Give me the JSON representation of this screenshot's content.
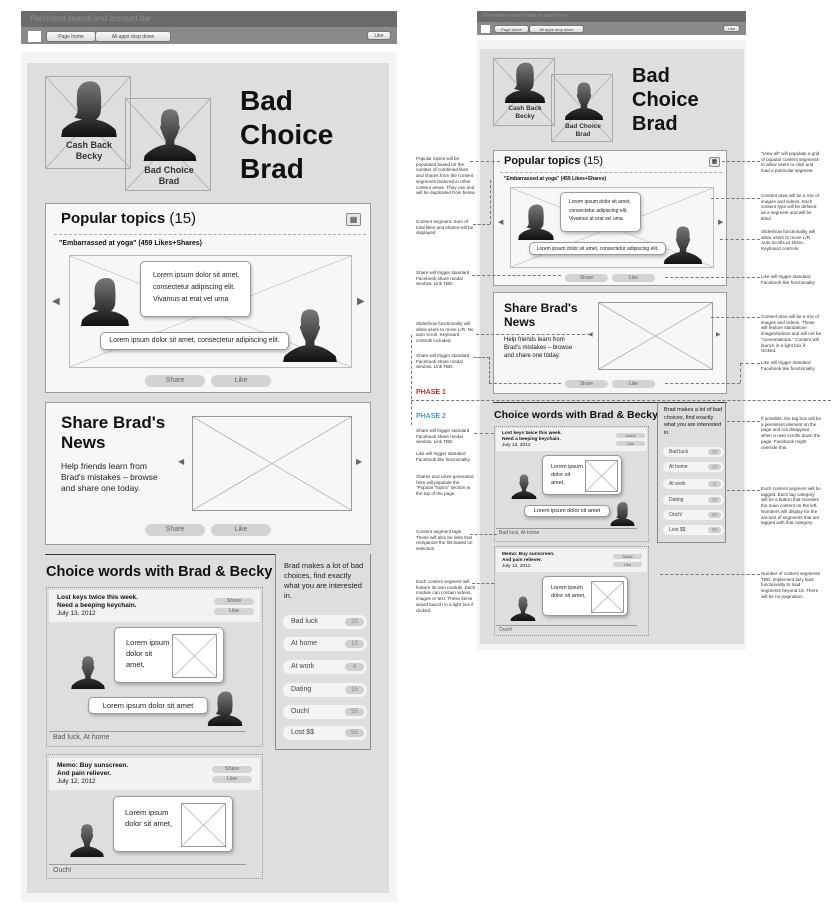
{
  "wireframe": {
    "header": {
      "search_bar_label": "Persistent search and account bar",
      "nav_page_home": "Page home",
      "nav_all_apps": "All apps drop down",
      "like_button": "Like"
    },
    "hero": {
      "avatar_becky_label": "Cash Back Becky",
      "avatar_brad_label": "Bad Choice Brad",
      "title_line1": "Bad",
      "title_line2": "Choice",
      "title_line3": "Brad"
    },
    "popular": {
      "title": "Popular topics",
      "count": "(15)",
      "view_all_icon": "grid-icon",
      "topic": "\"Embarrassed at yoga\" (459 Likes+Shares)",
      "bubble_top": "Lorem ipsum dolor sit amet, consectetur adipiscing elit. Vivamus at erat vel urna",
      "bubble_bottom": "Lorem ipsum dolor sit amet, consectetur adipiscing elit.",
      "share": "Share",
      "like": "Like"
    },
    "share_news": {
      "title": "Share Brad's News",
      "desc": "Help friends learn from Brad's mistakes – browse and share one today.",
      "share": "Share",
      "like": "Like"
    },
    "choice_words": {
      "title": "Choice words with Brad & Becky",
      "segments": [
        {
          "headline1": "Lost keys twice this week.",
          "headline2": "Need a beeping keychain.",
          "date": "July 13, 2012",
          "share": "Share",
          "like": "Like",
          "bubble": "Lorem ipsum dolor sit amet,",
          "bubble2": "Lorem ipsum dolor sit amet",
          "tags": "Bad luck, At home"
        },
        {
          "headline1": "Memo: Buy sunscreen.",
          "headline2": "And pain reliever.",
          "date": "July 12, 2012",
          "share": "Share",
          "like": "Like",
          "bubble": "Lorem ipsum dolor sit amet,",
          "tags": "Ouch!"
        }
      ]
    },
    "tag_sidebar": {
      "intro": "Brad makes a lot of bad choices, find exactly what you are interested in.",
      "tags": [
        {
          "label": "Bad luck",
          "count": "23"
        },
        {
          "label": "At home",
          "count": "13"
        },
        {
          "label": "At work",
          "count": "4"
        },
        {
          "label": "Dating",
          "count": "15"
        },
        {
          "label": "Ouch!",
          "count": "55"
        },
        {
          "label": "Lost $$",
          "count": "55"
        }
      ]
    }
  },
  "annotations": {
    "left": {
      "popular_topics": "Popular topics will be populated based on the number of combined likes and shares from the content segments featured in other content areas. They can and will be duplicated from below.",
      "content_segment": "Content segment. Sum of total likes and shares will be displayed.",
      "share_popular": "Share will trigger standard Facebook share modal window. Link TBD.",
      "slideshow": "Slideshow functionality will allow users to move L/R. No auto scroll. Keyboard controls included.",
      "share_news": "Share will trigger standard Facebook share modal window. Link TBD.",
      "phase1": "PHASE 1",
      "phase2": "PHASE 2",
      "share_segment": "Share will trigger standard Facebook share modal window. Link TBD.",
      "like_segment": "Like will trigger standard Facebook like functionality.",
      "shares_likes": "Shares and Likes generated here will populate the \"Popular Topics\" section at the top of the page.",
      "content_tags": "Content segment tags. These will also be links that reorganize the list based on selection.",
      "each_segment": "Each content segment will feature its own module. Each module can contain videos, images or text. These items would launch in a light box if clicked."
    },
    "right": {
      "view_all": "\"View all\" will populate a grid of popular content segments to allow users to click and load a particular segment.",
      "content_mix": "Content area will be a mix of images and videos. Each content type will be defined as a segment and will be titled.",
      "slideshow_auto": "Slideshow functionality will allow users to move L/R. Auto scrolls at 10sec. Keyboard controls.",
      "like_popular": "Like will trigger standard Facebook like functionality",
      "content_standalone": "Content area will be a mix of images and videos. These will feature standalone images/videos and will not be \"conversations.\" Content will launch in a light box if clicked.",
      "like_news": "Like will trigger standard Facebook like functionality",
      "tag_box": "If possible, the tag box will be a persistent element on the page and not disappear when a user scrolls down the page. Facebook might override this.",
      "tag_category": "Each content segment will be tagged. Each tag category will be a button that reorders the main content on the left. Numbers will display for the amount of segments that are tagged with that category.",
      "lazy_load": "Number of content segments TBD. Implement lazy load functionality to load segments beyond 15. There will be no pagination."
    },
    "colors": {
      "phase1": "#e02020",
      "phase2": "#2aa8e0"
    }
  }
}
